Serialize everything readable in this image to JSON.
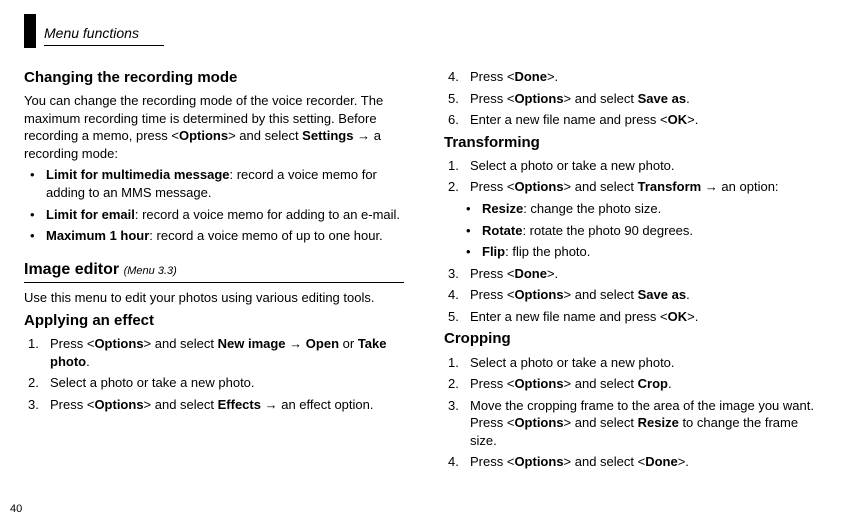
{
  "header": {
    "breadcrumb": "Menu functions"
  },
  "page_number": "40",
  "left": {
    "h1": "Changing the recording mode",
    "intro_html": "You can change the recording mode of the voice recorder. The maximum recording time is determined by this setting. Before recording a memo, press &lt;<b>Options</b>&gt; and select <b>Settings</b> → a recording mode:",
    "bullets": [
      "<b>Limit for multimedia message</b>: record a voice memo for adding to an MMS message.",
      "<b>Limit for email</b>: record a voice memo for adding to an e-mail.",
      "<b>Maximum 1 hour</b>: record a voice memo of up to one hour."
    ],
    "section_title": "Image editor",
    "section_ref": "(Menu 3.3)",
    "section_intro": "Use this menu to edit your photos using various editing tools.",
    "h2": "Applying an effect",
    "steps": [
      "Press &lt;<b>Options</b>&gt; and select <b>New image</b>  → <b>Open</b> or <b>Take photo</b>.",
      "Select a photo or take a new photo.",
      "Press &lt;<b>Options</b>&gt; and select <b>Effects</b> → an effect option."
    ]
  },
  "right": {
    "steps_cont_start": 4,
    "steps_cont": [
      "Press &lt;<b>Done</b>&gt;.",
      "Press &lt;<b>Options</b>&gt; and select <b>Save as</b>.",
      "Enter a new file name and press &lt;<b>OK</b>&gt;."
    ],
    "h1": "Transforming",
    "steps1": [
      "Select a photo or take a new photo.",
      "Press &lt;<b>Options</b>&gt; and select <b>Transform</b> → an option:"
    ],
    "sub_bullets": [
      "<b>Resize</b>: change the photo size.",
      "<b>Rotate</b>: rotate the photo 90 degrees.",
      "<b>Flip</b>: flip the photo."
    ],
    "steps1b_start": 3,
    "steps1b": [
      "Press &lt;<b>Done</b>&gt;.",
      "Press &lt;<b>Options</b>&gt; and select <b>Save as</b>.",
      "Enter a new file name and press &lt;<b>OK</b>&gt;."
    ],
    "h2": "Cropping",
    "steps2": [
      "Select a photo or take a new photo.",
      "Press &lt;<b>Options</b>&gt; and select <b>Crop</b>.",
      "Move the cropping frame to the area of the image you want. Press &lt;<b>Options</b>&gt; and select <b>Resize</b> to change the frame size.",
      "Press &lt;<b>Options</b>&gt; and select &lt;<b>Done</b>&gt;."
    ]
  }
}
